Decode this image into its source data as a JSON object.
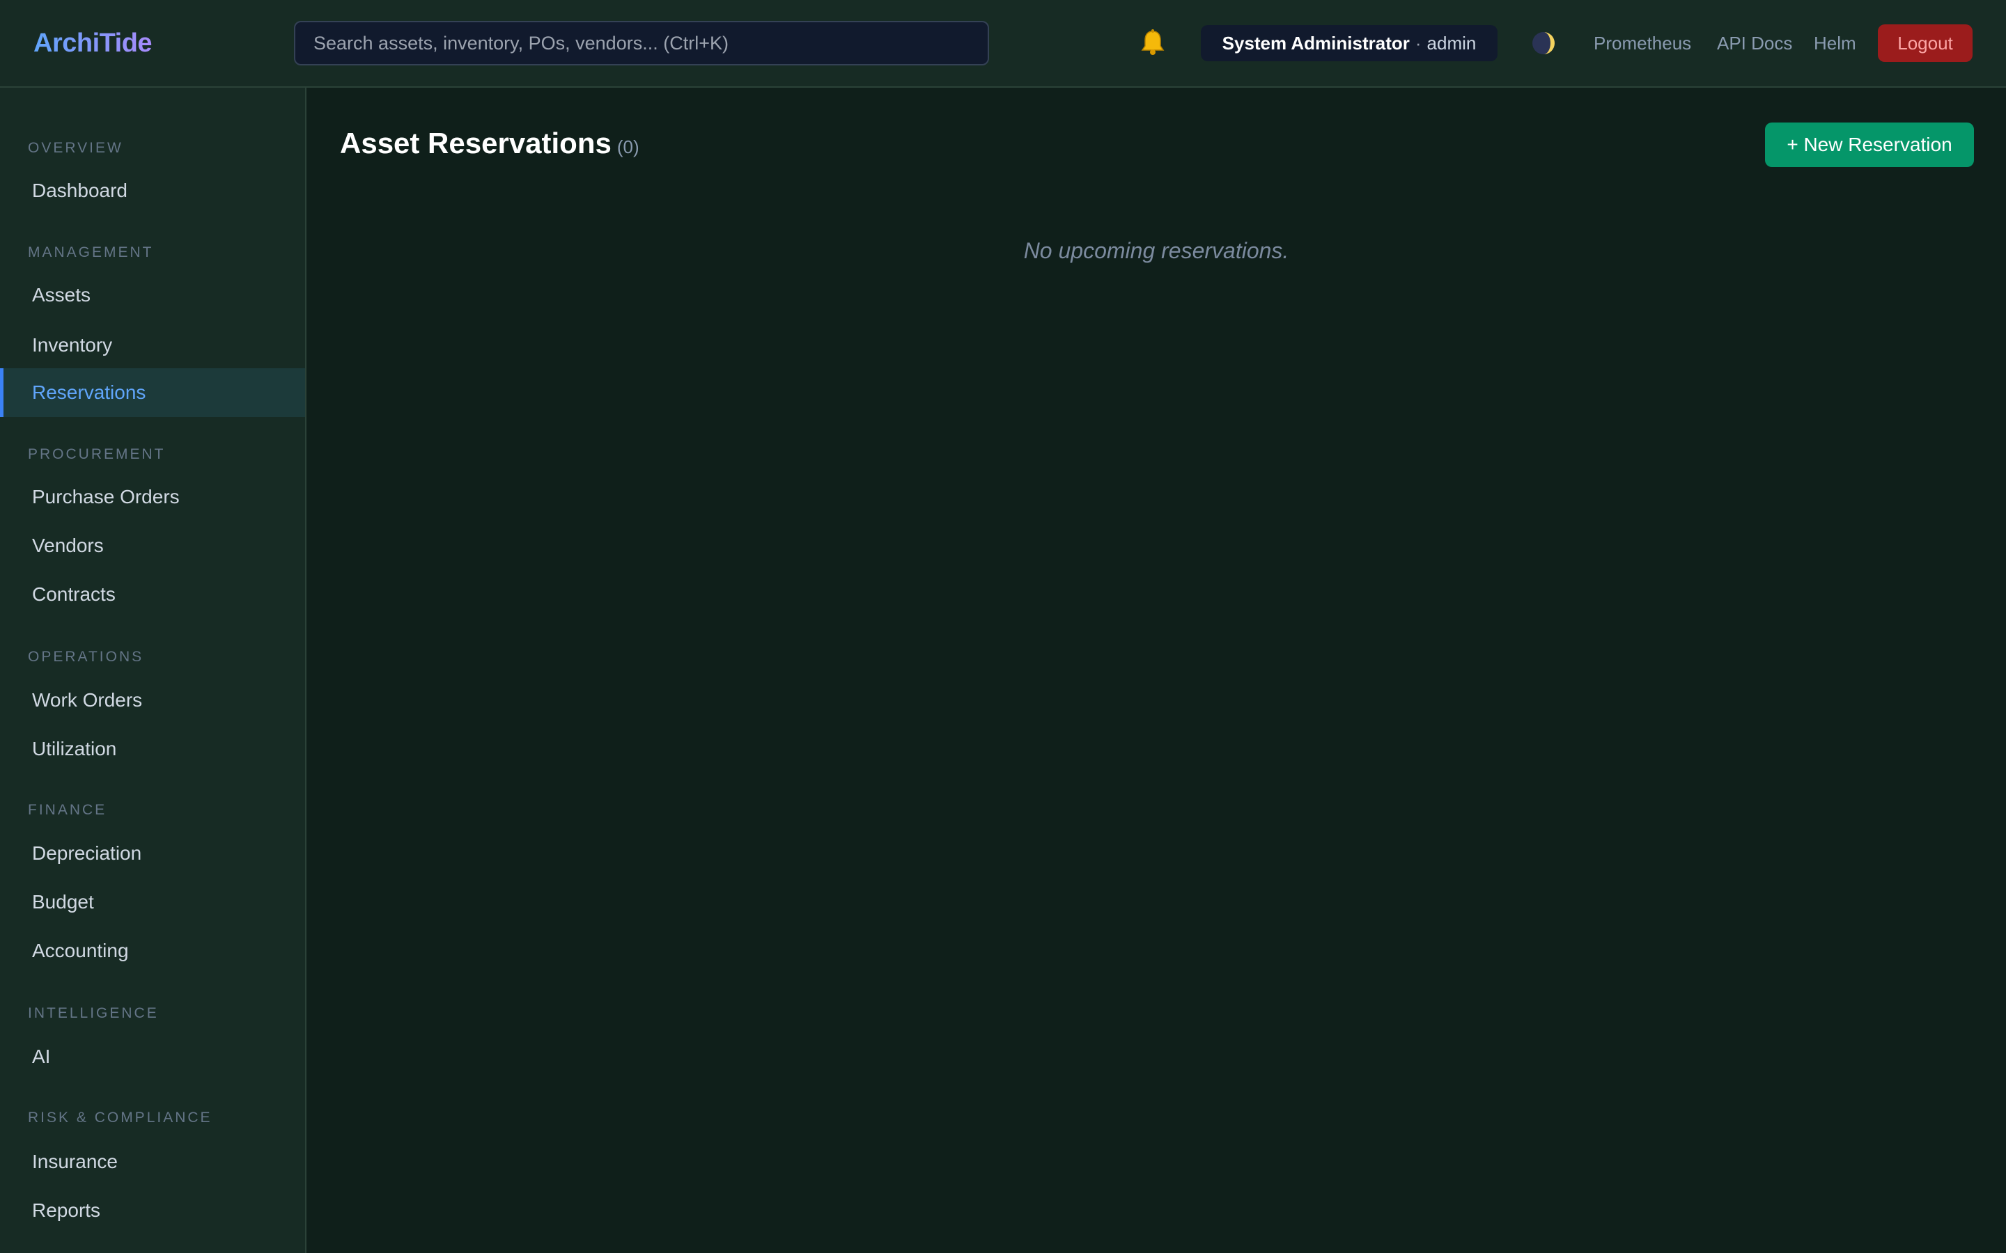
{
  "app": {
    "name": "ArchiTide"
  },
  "header": {
    "search_placeholder": "Search assets, inventory, POs, vendors... (Ctrl+K)",
    "user": {
      "name": "System Administrator",
      "separator": "·",
      "role": "admin"
    },
    "links": {
      "prometheus": "Prometheus",
      "api_docs": "API Docs",
      "helm": "Helm"
    },
    "logout_label": "Logout",
    "icons": {
      "notifications": "bell-icon",
      "theme": "theme-toggle-icon"
    }
  },
  "sidebar": {
    "sections": [
      {
        "title": "OVERVIEW",
        "items": [
          {
            "label": "Dashboard",
            "active": false
          }
        ]
      },
      {
        "title": "MANAGEMENT",
        "items": [
          {
            "label": "Assets",
            "active": false
          },
          {
            "label": "Inventory",
            "active": false
          },
          {
            "label": "Reservations",
            "active": true
          }
        ]
      },
      {
        "title": "PROCUREMENT",
        "items": [
          {
            "label": "Purchase Orders",
            "active": false
          },
          {
            "label": "Vendors",
            "active": false
          },
          {
            "label": "Contracts",
            "active": false
          }
        ]
      },
      {
        "title": "OPERATIONS",
        "items": [
          {
            "label": "Work Orders",
            "active": false
          },
          {
            "label": "Utilization",
            "active": false
          }
        ]
      },
      {
        "title": "FINANCE",
        "items": [
          {
            "label": "Depreciation",
            "active": false
          },
          {
            "label": "Budget",
            "active": false
          },
          {
            "label": "Accounting",
            "active": false
          }
        ]
      },
      {
        "title": "INTELLIGENCE",
        "items": [
          {
            "label": "AI",
            "active": false
          }
        ]
      },
      {
        "title": "RISK & COMPLIANCE",
        "items": [
          {
            "label": "Insurance",
            "active": false
          },
          {
            "label": "Reports",
            "active": false
          }
        ]
      }
    ]
  },
  "main": {
    "title": "Asset Reservations",
    "count": "(0)",
    "new_button_label": "+ New Reservation",
    "empty_message": "No upcoming reservations."
  },
  "colors": {
    "accent": "#3b82f6",
    "primary_button": "#059669",
    "danger_button": "#9b1c1c",
    "background": "#0f1f1a",
    "panel": "#172b24"
  }
}
